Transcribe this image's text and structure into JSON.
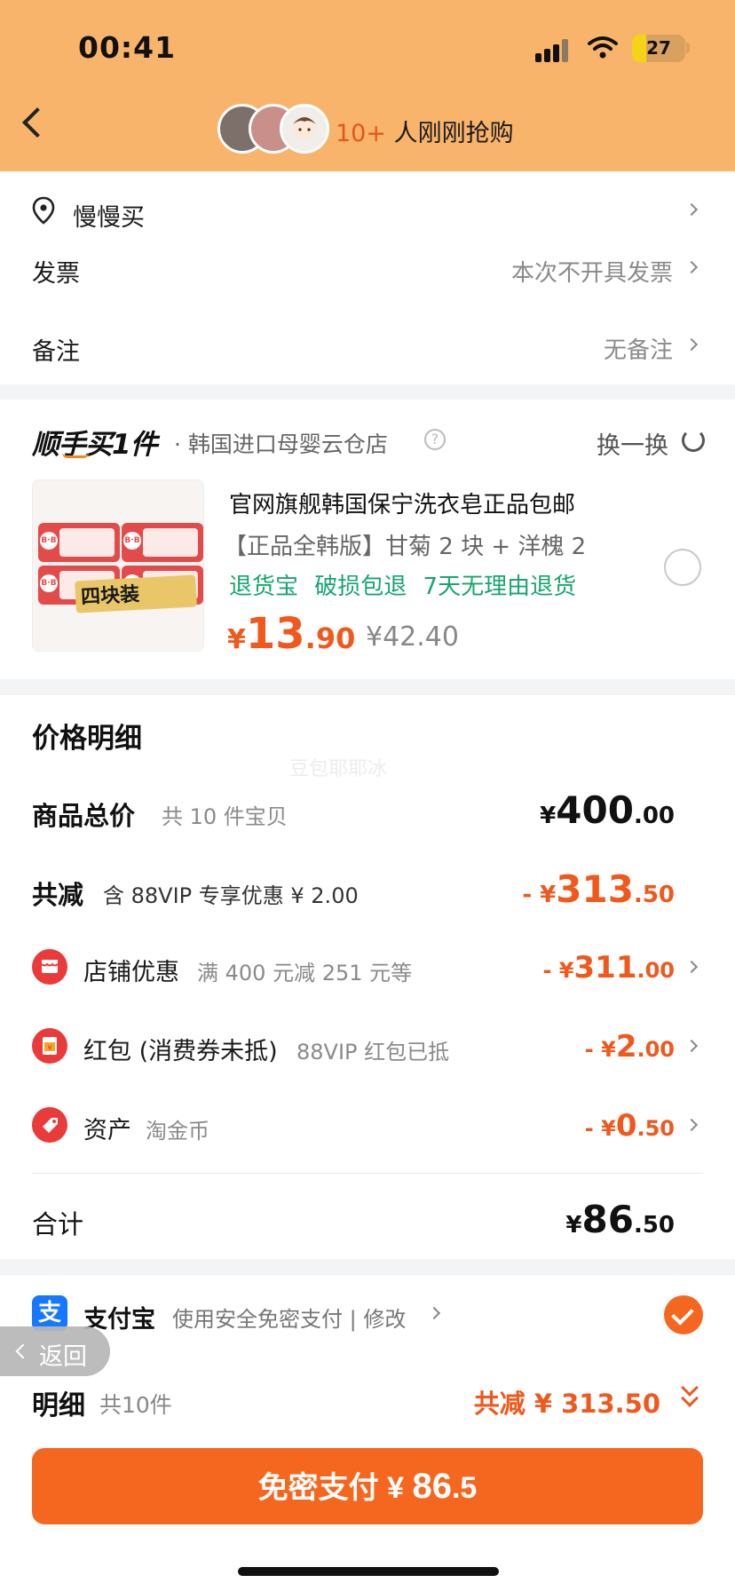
{
  "status_bar": {
    "time": "00:41",
    "battery": "27",
    "battery_level": 0.27
  },
  "header": {
    "buyer_count": "10+",
    "buyer_text": "人刚刚抢购"
  },
  "address": {
    "name": "慢慢买"
  },
  "invoice": {
    "label": "发票",
    "value": "本次不开具发票"
  },
  "note": {
    "label": "备注",
    "value": "无备注"
  },
  "shop_bar": {
    "logo_text": "顺手买1件",
    "store": "· 韩国进口母婴云仓店",
    "help_glyph": "?",
    "swap_label": "换一换"
  },
  "product": {
    "title": "官网旗舰韩国保宁洗衣皂正品包邮",
    "spec": "【正品全韩版】甘菊 2 块 + 洋槐 2",
    "tags": "退货宝 破损包退 7天无理由退货",
    "price_yen": "¥",
    "price_int": "13",
    "price_dec": ".90",
    "original_price": "¥42.40",
    "thumb_caption": "四块装",
    "thumb_brand": "B·B"
  },
  "price_detail": {
    "title": "价格明细",
    "watermark": "豆包耶耶冰",
    "goods_total": {
      "label": "商品总价",
      "sub": "共 10 件宝贝",
      "yen": "¥",
      "int": "400",
      "dec": ".00"
    },
    "reduction": {
      "label": "共减",
      "sub": "含 88VIP 专享优惠 ¥ 2.00",
      "yen": "- ¥",
      "int": "313",
      "dec": ".50"
    },
    "items": [
      {
        "label": "店铺优惠",
        "sub": "满 400 元减 251 元等",
        "yen": "- ¥",
        "int": "311",
        "dec": ".00",
        "icon": "store-icon"
      },
      {
        "label": "红包 (消费券未抵)",
        "sub": "88VIP 红包已抵",
        "yen": "- ¥",
        "int": "2",
        "dec": ".00",
        "icon": "red-packet-icon"
      },
      {
        "label": "资产",
        "sub": "淘金币",
        "yen": "- ¥",
        "int": "0",
        "dec": ".50",
        "icon": "coin-tag-icon"
      }
    ],
    "total": {
      "label": "合计",
      "yen": "¥",
      "int": "86",
      "dec": ".50"
    }
  },
  "payment": {
    "icon_glyph": "支",
    "name": "支付宝",
    "desc": "使用安全免密支付 | 修改"
  },
  "back_pill": {
    "label": "返回"
  },
  "summary": {
    "label": "明细",
    "count": "共10件",
    "reduction": "共减 ¥ 313.50"
  },
  "pay_button": {
    "label": "免密支付 ¥",
    "int": "86",
    "dec": ".5"
  },
  "colors": {
    "header_bg": "#f9b46c",
    "accent": "#f0581c",
    "button": "#f5671f",
    "green": "#18a570",
    "alipay": "#1677ff"
  }
}
